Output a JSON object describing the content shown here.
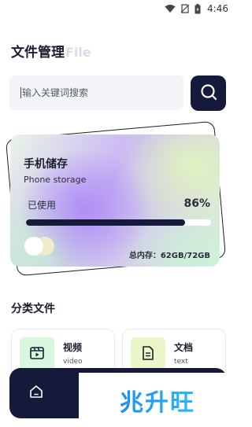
{
  "status": {
    "time": "4:46"
  },
  "header": {
    "title_cn": "文件管理",
    "title_en": "File"
  },
  "search": {
    "placeholder": "输入关键词搜索"
  },
  "storage": {
    "title": "手机储存",
    "subtitle": "Phone storage",
    "used_label": "已使用",
    "used_percent_text": "86%",
    "used_fraction": 0.86,
    "total_label": "总内存：62GB/72GB"
  },
  "categories": {
    "title": "分类文件",
    "items": [
      {
        "name": "视频",
        "sub": "video"
      },
      {
        "name": "文档",
        "sub": "text"
      }
    ]
  },
  "watermark": {
    "text": "兆升旺"
  },
  "colors": {
    "primary": "#151a3a",
    "video_bg": "#d9f7dc",
    "doc_bg": "#eaf7c9"
  }
}
